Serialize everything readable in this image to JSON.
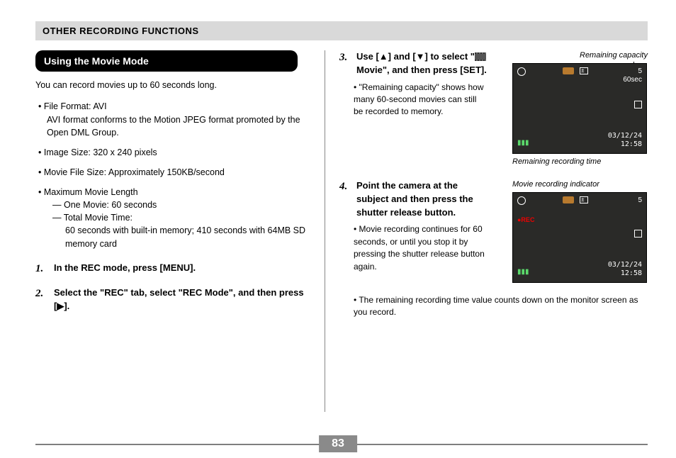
{
  "header": "OTHER RECORDING FUNCTIONS",
  "sectionTitle": "Using the Movie Mode",
  "intro": "You can record movies up to 60 seconds long.",
  "bullets": {
    "b1_title": "File Format: AVI",
    "b1_sub": "AVI format conforms to the Motion JPEG format promoted by the Open DML Group.",
    "b2": "Image Size: 320 x 240 pixels",
    "b3": "Movie File Size: Approximately 150KB/second",
    "b4_title": "Maximum Movie Length",
    "b4_s1": "One Movie: 60 seconds",
    "b4_s2": "Total Movie Time:",
    "b4_s2b": "60 seconds with built-in memory; 410 seconds with 64MB SD memory card"
  },
  "steps": {
    "s1": "In the REC mode, press [MENU].",
    "s2": "Select the \"REC\" tab, select \"REC Mode\", and then press [▶].",
    "s3_a": "Use [▲] and [▼] to select \"",
    "s3_b": " Movie\", and then press [SET].",
    "s3_bullet": "\"Remaining capacity\" shows how many 60-second movies can still be recorded to memory.",
    "s4": "Point the camera at the subject and then press the shutter release button.",
    "s4_bullet": "Movie recording continues for 60 seconds, or until you stop it by pressing the shutter release button again.",
    "s4_full": "The remaining recording time value counts down on the monitor screen as you record."
  },
  "annot": {
    "cap": "Remaining capacity",
    "rrt": "Remaining recording time",
    "mri": "Movie recording indicator"
  },
  "screen": {
    "count": "5",
    "sec": "60sec",
    "rec_label": "●REC",
    "date": "03/12/24",
    "time": "12:58"
  },
  "pageNum": "83"
}
